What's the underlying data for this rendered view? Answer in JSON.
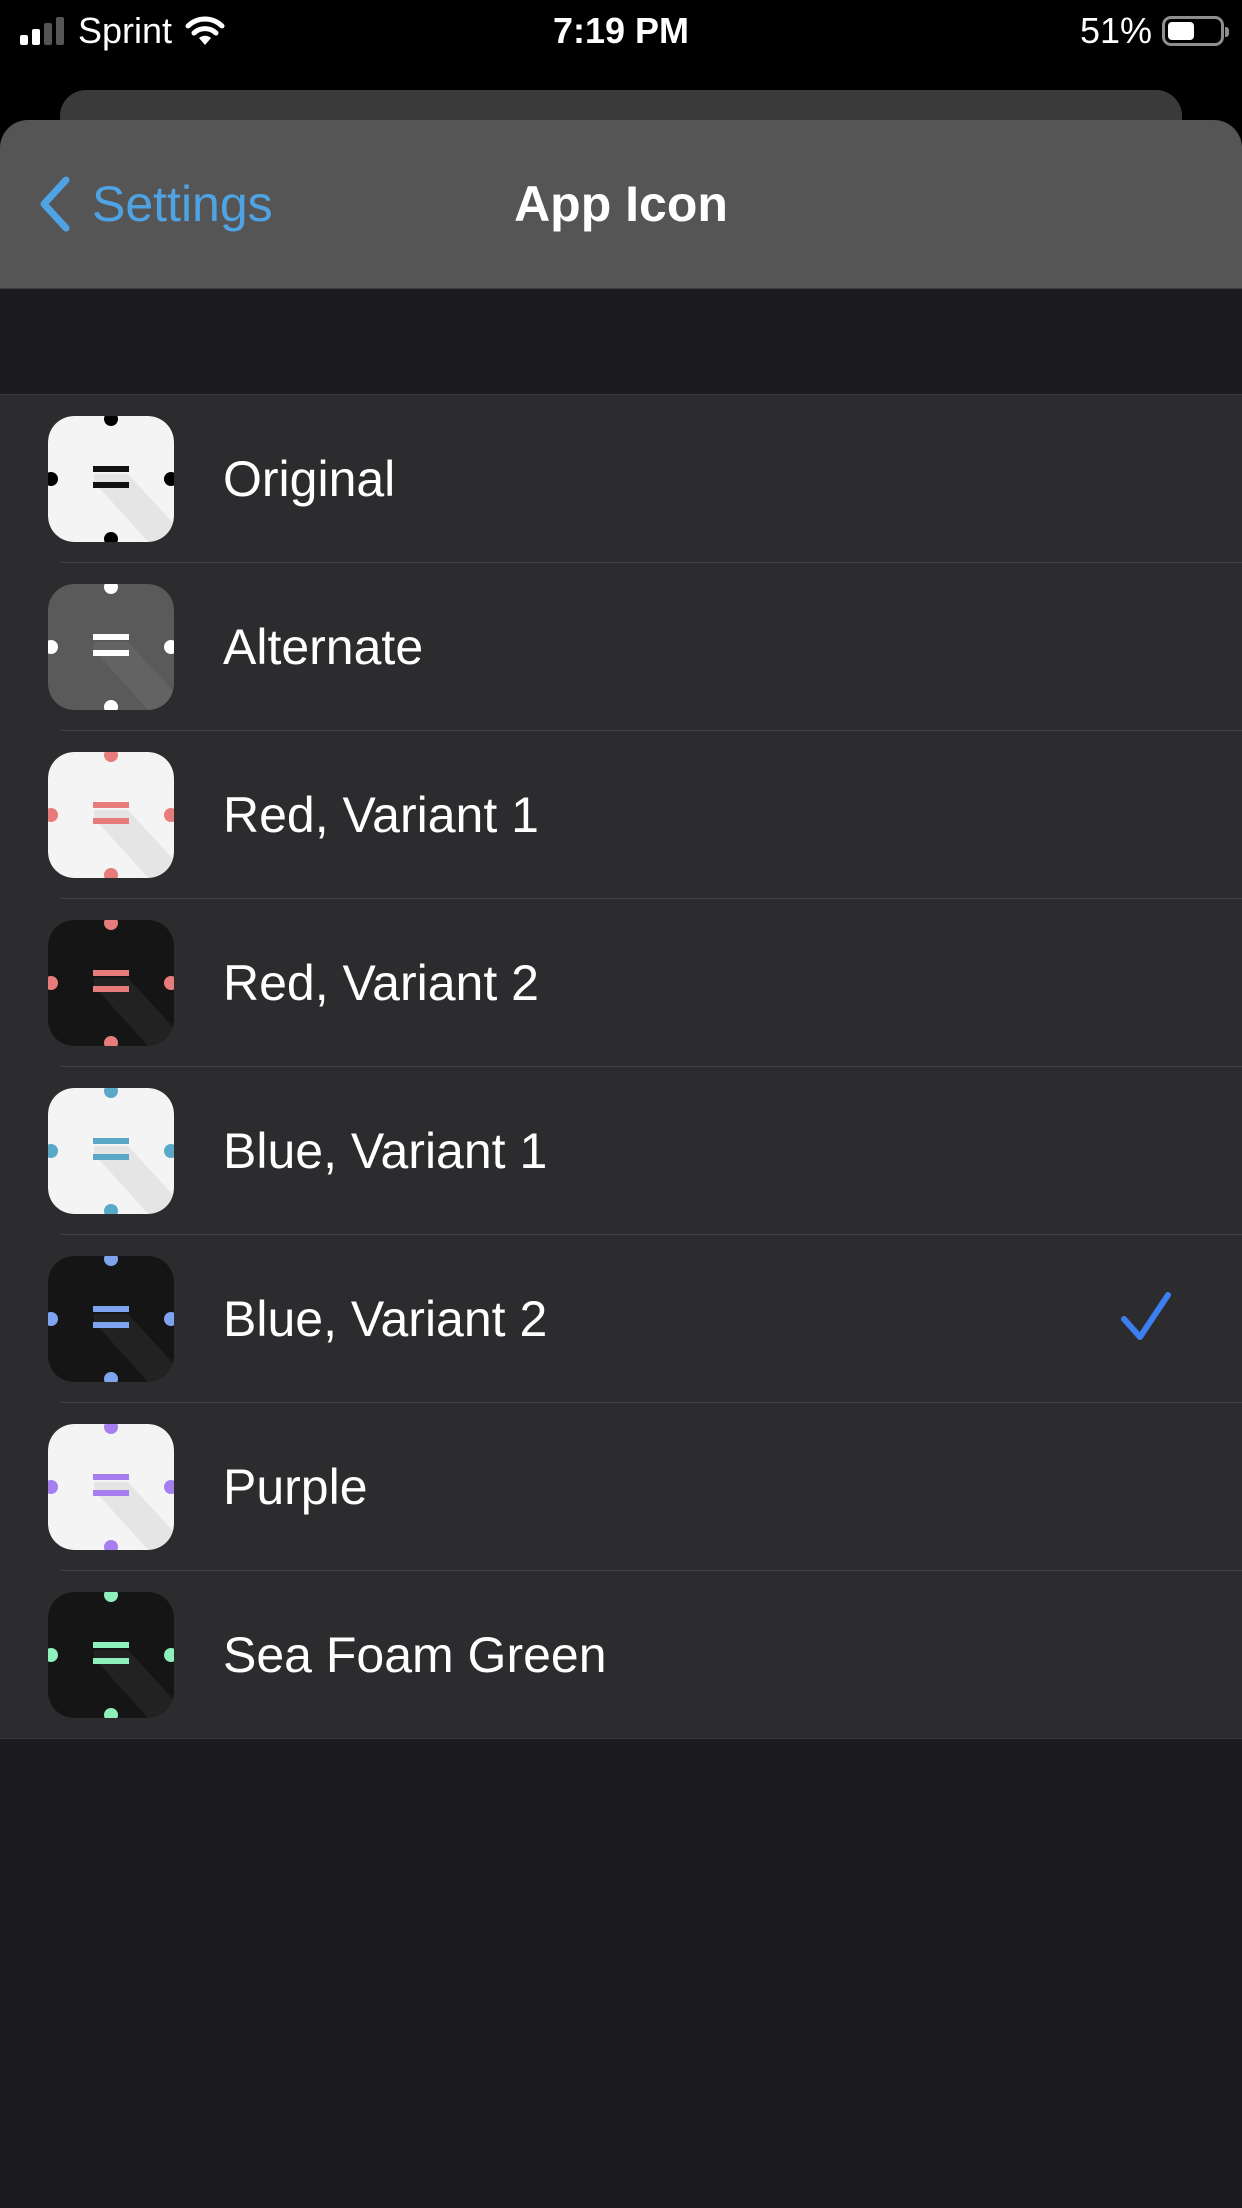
{
  "status_bar": {
    "carrier": "Sprint",
    "time": "7:19 PM",
    "battery_percent": "51%",
    "battery_level": 0.51,
    "signal_bars_active": 2,
    "signal_bars_total": 4
  },
  "nav": {
    "back_label": "Settings",
    "title": "App Icon"
  },
  "accent_color": "#4fa3e3",
  "check_color": "#3b7ff0",
  "icons": [
    {
      "label": "Original",
      "bg": "#f4f4f4",
      "fg": "#111111",
      "dot": "#000000",
      "selected": false
    },
    {
      "label": "Alternate",
      "bg": "#5a5a5a",
      "fg": "#ffffff",
      "dot": "#ffffff",
      "selected": false
    },
    {
      "label": "Red, Variant 1",
      "bg": "#f4f4f4",
      "fg": "#e87c7c",
      "dot": "#e87c7c",
      "selected": false
    },
    {
      "label": "Red, Variant 2",
      "bg": "#151515",
      "fg": "#e87c7c",
      "dot": "#e87c7c",
      "selected": false
    },
    {
      "label": "Blue, Variant 1",
      "bg": "#f4f4f4",
      "fg": "#5aa8c8",
      "dot": "#5aa8c8",
      "selected": false
    },
    {
      "label": "Blue, Variant 2",
      "bg": "#151515",
      "fg": "#7ea4f0",
      "dot": "#7ea4f0",
      "selected": true
    },
    {
      "label": "Purple",
      "bg": "#f4f4f4",
      "fg": "#a77ef0",
      "dot": "#a77ef0",
      "selected": false
    },
    {
      "label": "Sea Foam Green",
      "bg": "#151515",
      "fg": "#8ef0bb",
      "dot": "#8ef0bb",
      "selected": false
    }
  ]
}
